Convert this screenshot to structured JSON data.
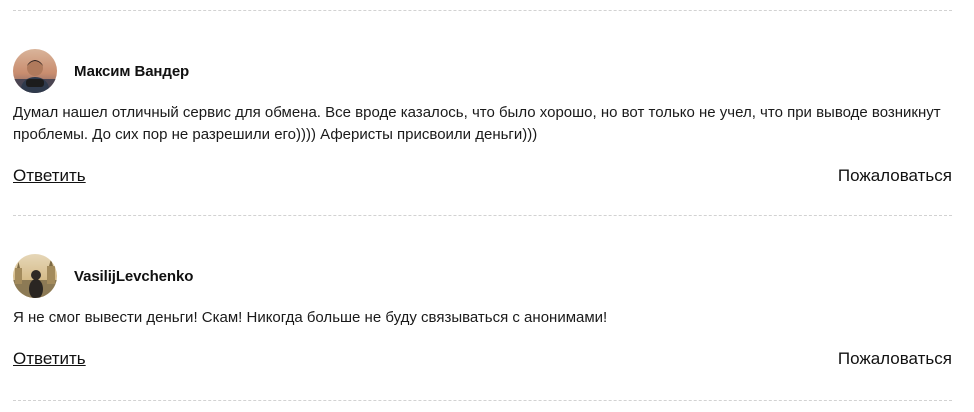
{
  "comments": [
    {
      "author": "Максим Вандер",
      "text": "Думал нашел отличный сервис для обмена. Все вроде казалось, что было хорошо, но вот только не учел, что при выводе возникнут проблемы. До сих пор не разрешили его)))) Аферисты присвоили деньги)))",
      "reply_label": "Ответить",
      "report_label": "Пожаловаться"
    },
    {
      "author": "VasilijLevchenko",
      "text": "Я не смог вывести деньги! Скам! Никогда больше не буду связываться с анонимами!",
      "reply_label": "Ответить",
      "report_label": "Пожаловаться"
    }
  ]
}
